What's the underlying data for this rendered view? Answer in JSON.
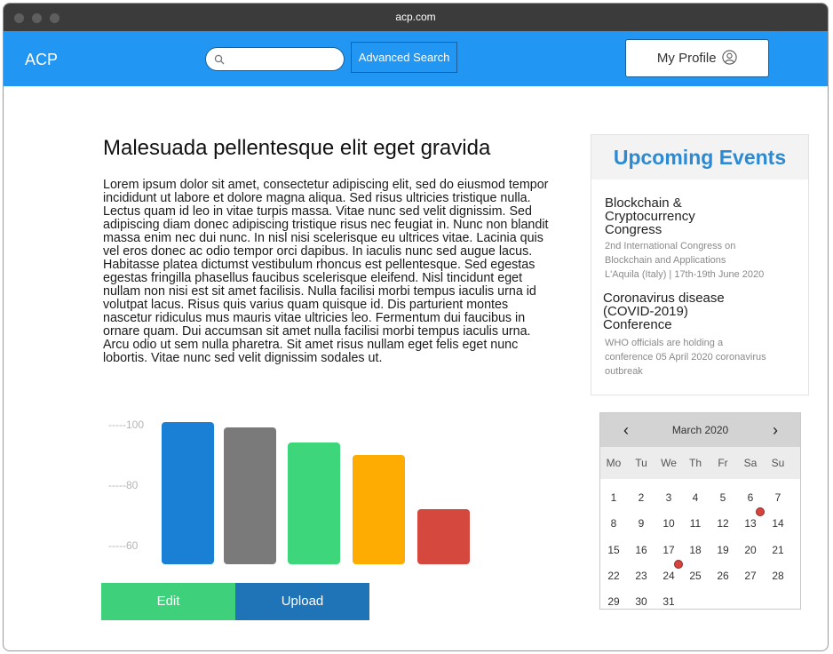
{
  "window": {
    "url": "acp.com"
  },
  "navbar": {
    "brand": "ACP",
    "search_placeholder": "",
    "advanced_search": "Advanced Search",
    "profile": "My Profile"
  },
  "article": {
    "title": "Malesuada pellentesque elit eget gravida",
    "body": "Lorem ipsum dolor sit amet, consectetur adipiscing elit, sed do eiusmod tempor incididunt ut labore et dolore magna aliqua. Sed risus ultricies tristique nulla. Lectus quam id leo in vitae turpis massa. Vitae nunc sed velit dignissim. Sed adipiscing diam donec adipiscing tristique risus nec feugiat in. Nunc non blandit massa enim nec dui nunc. In nisl nisi scelerisque eu ultrices vitae. Lacinia quis vel eros donec ac odio tempor orci dapibus. In iaculis nunc sed augue lacus. Habitasse platea dictumst vestibulum rhoncus est pellentesque. Sed egestas egestas fringilla phasellus faucibus scelerisque eleifend. Nisl tincidunt eget nullam non nisi est sit amet facilisis. Nulla facilisi morbi tempus iaculis urna id volutpat lacus. Risus quis varius quam quisque id. Dis parturient montes nascetur ridiculus mus mauris vitae ultricies leo. Fermentum dui faucibus in ornare quam. Dui accumsan sit amet nulla facilisi morbi tempus iaculis urna. Arcu odio ut sem nulla pharetra. Sit amet risus nullam eget felis eget nunc lobortis. Vitae nunc sed velit dignissim sodales ut."
  },
  "chart_data": {
    "type": "bar",
    "tick_labels": [
      "-----100",
      "-----80",
      "-----60"
    ],
    "yticks": [
      100,
      80,
      60
    ],
    "ylim": [
      50,
      101
    ],
    "values": [
      101,
      99,
      94,
      90,
      72
    ],
    "colors": [
      "#1e7fd1",
      "#7a7a7a",
      "#43d47d",
      "#ffac0a",
      "#d0493f"
    ],
    "grid": false,
    "legend": false
  },
  "actions": {
    "edit": "Edit",
    "upload": "Upload"
  },
  "events": {
    "heading": "Upcoming Events",
    "items": [
      {
        "title_lines": [
          "Blockchain &",
          "Cryptocurrency",
          "Congress"
        ],
        "desc_lines": [
          "2nd International Congress on",
          "Blockchain and Applications",
          "L'Aquila (Italy) | 17th-19th June 2020"
        ]
      },
      {
        "title_lines": [
          "Coronavirus disease",
          "(COVID-2019)",
          "Conference"
        ],
        "desc_lines": [
          "WHO officials are holding a",
          "conference 05 April 2020 coronavirus",
          "outbreak"
        ]
      }
    ]
  },
  "calendar": {
    "prev": "‹",
    "next": "›",
    "month": "March 2020",
    "weekdays": [
      "Mo",
      "Tu",
      "We",
      "Th",
      "Fr",
      "Sa",
      "Su"
    ],
    "weeks": [
      [
        "1",
        "2",
        "3",
        "4",
        "5",
        "6",
        "7"
      ],
      [
        "8",
        "9",
        "10",
        "11",
        "12",
        "13",
        "14"
      ],
      [
        "15",
        "16",
        "17",
        "18",
        "19",
        "20",
        "21"
      ],
      [
        "22",
        "23",
        "24",
        "25",
        "26",
        "27",
        "28"
      ],
      [
        "29",
        "30",
        "31"
      ]
    ],
    "marked_days": [
      "13",
      "24"
    ],
    "marker_color": "#d6453d"
  }
}
